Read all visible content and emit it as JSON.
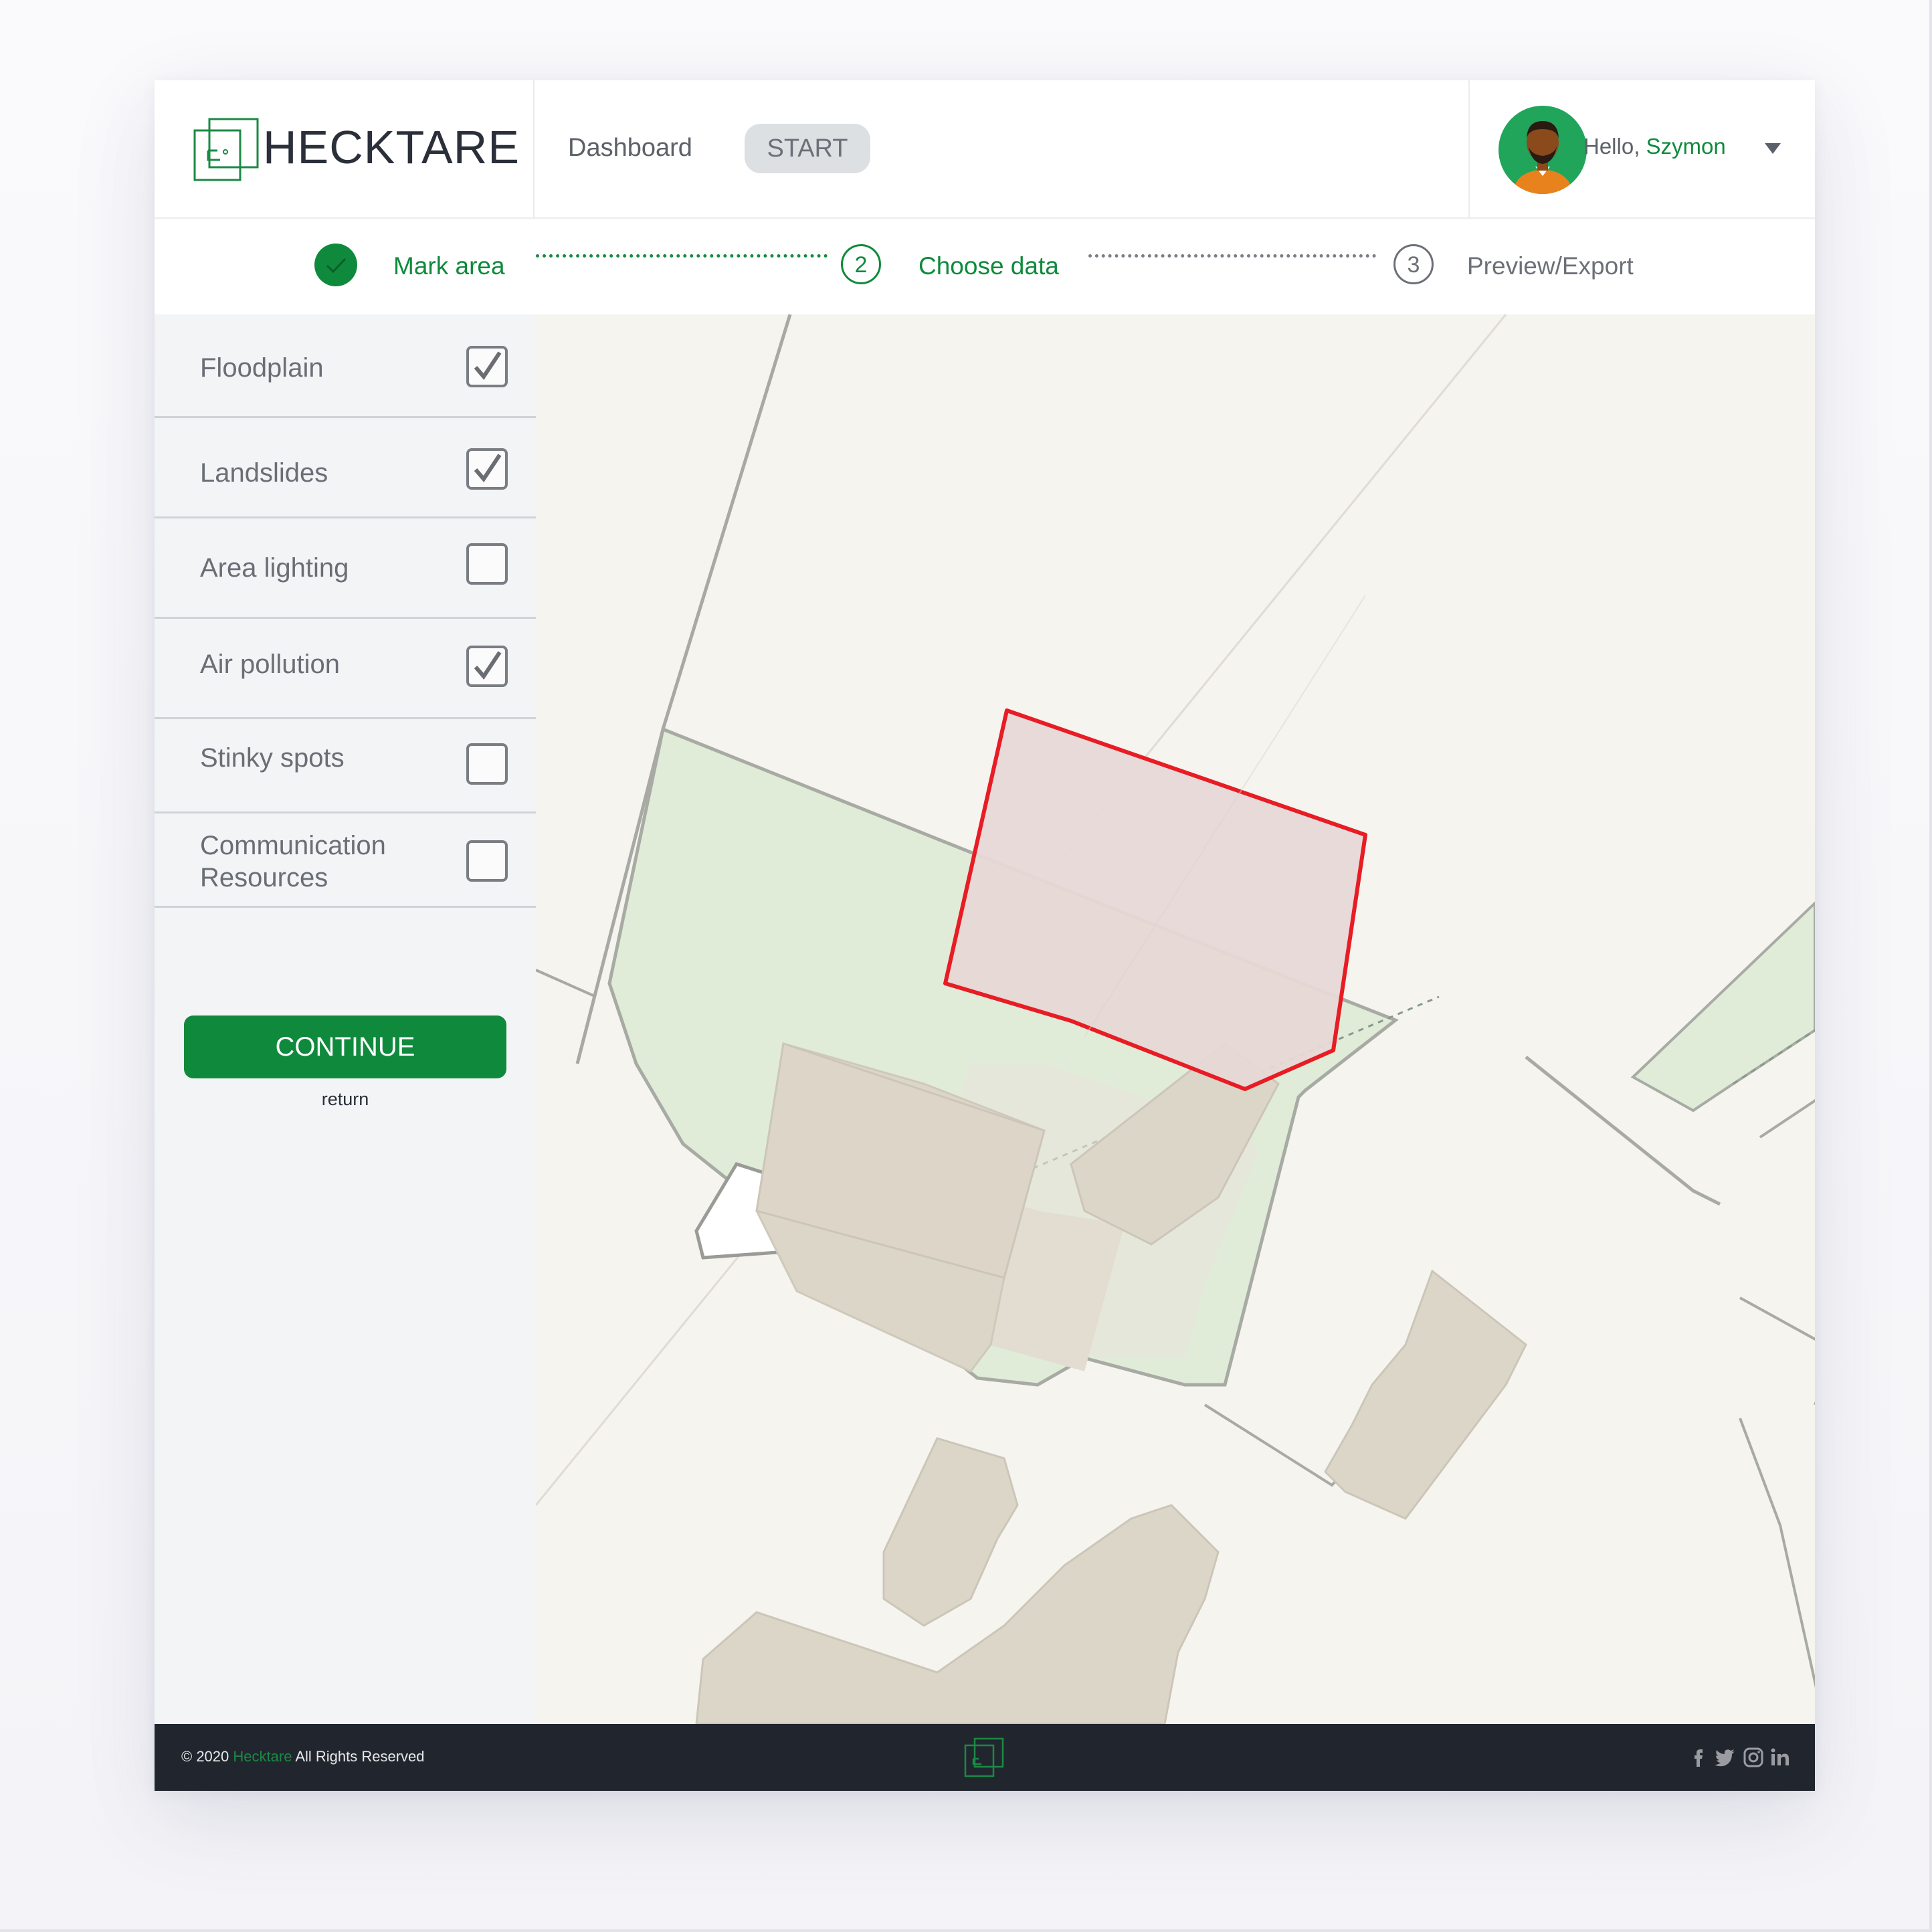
{
  "header": {
    "logo_text": "HECKTARE",
    "nav": {
      "dashboard": "Dashboard",
      "start": "START"
    },
    "user": {
      "greeting": "Hello, ",
      "name": "Szymon"
    }
  },
  "stepper": {
    "steps": [
      {
        "label": "Mark area",
        "state": "done"
      },
      {
        "number": "2",
        "label": "Choose data",
        "state": "active"
      },
      {
        "number": "3",
        "label": "Preview/Export",
        "state": "pending"
      }
    ]
  },
  "sidebar": {
    "options": [
      {
        "label": "Floodplain",
        "checked": true
      },
      {
        "label": "Landslides",
        "checked": true
      },
      {
        "label": "Area lighting",
        "checked": false
      },
      {
        "label": "Air pollution",
        "checked": true
      },
      {
        "label": "Stinky spots",
        "checked": false
      },
      {
        "label_line1": "Communication",
        "label_line2": "Resources",
        "checked": false
      }
    ],
    "continue_label": "CONTINUE",
    "return_label": "return"
  },
  "footer": {
    "copyright_prefix": "© 2020 ",
    "brand": "Hecktare",
    "copyright_suffix": " All Rights Reserved",
    "social_icons": [
      "facebook-icon",
      "twitter-icon",
      "instagram-icon",
      "linkedin-icon"
    ]
  },
  "colors": {
    "accent": "#0f8a3c",
    "selection": "#e81c24",
    "footer_bg": "#21262e",
    "sidebar_bg": "#f3f4f6"
  }
}
